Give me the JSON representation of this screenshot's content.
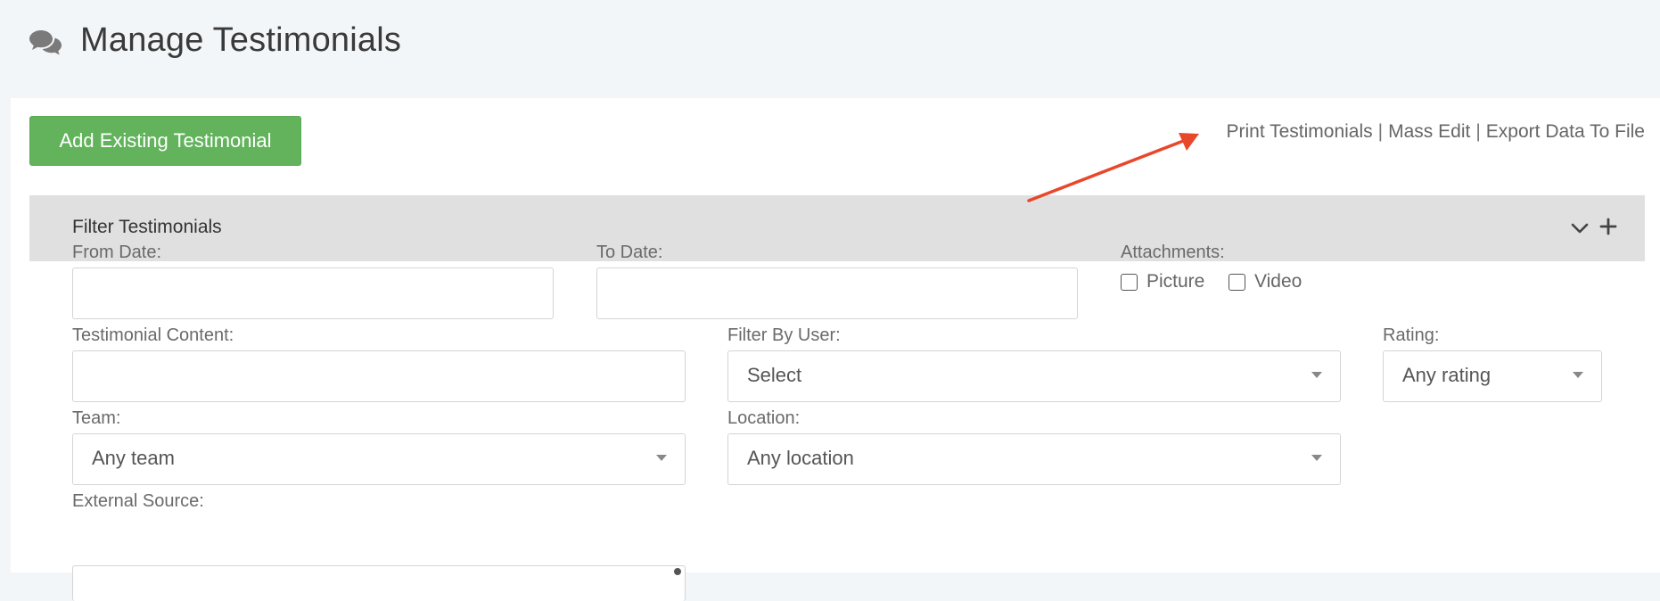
{
  "header": {
    "title": "Manage Testimonials",
    "icon": "chat-bubbles-icon"
  },
  "toolbar": {
    "add_label": "Add Existing Testimonial",
    "links": [
      "Print Testimonials",
      "Mass Edit",
      "Export Data To File"
    ],
    "separator": "|"
  },
  "annotation": {
    "arrow_color": "#e8472a"
  },
  "filter": {
    "title": "Filter Testimonials",
    "from_date_label": "From Date:",
    "from_date_value": "",
    "to_date_label": "To Date:",
    "to_date_value": "",
    "attachments_label": "Attachments:",
    "attachment_options": [
      "Picture",
      "Video"
    ],
    "content_label": "Testimonial Content:",
    "content_value": "",
    "user_label": "Filter By User:",
    "user_value": "Select",
    "rating_label": "Rating:",
    "rating_value": "Any rating",
    "team_label": "Team:",
    "team_value": "Any team",
    "location_label": "Location:",
    "location_value": "Any location",
    "external_source_label": "External Source:"
  },
  "colors": {
    "primary_button": "#62b35c",
    "filter_bar": "#e0e0e0",
    "page_bg": "#f3f6f8"
  }
}
